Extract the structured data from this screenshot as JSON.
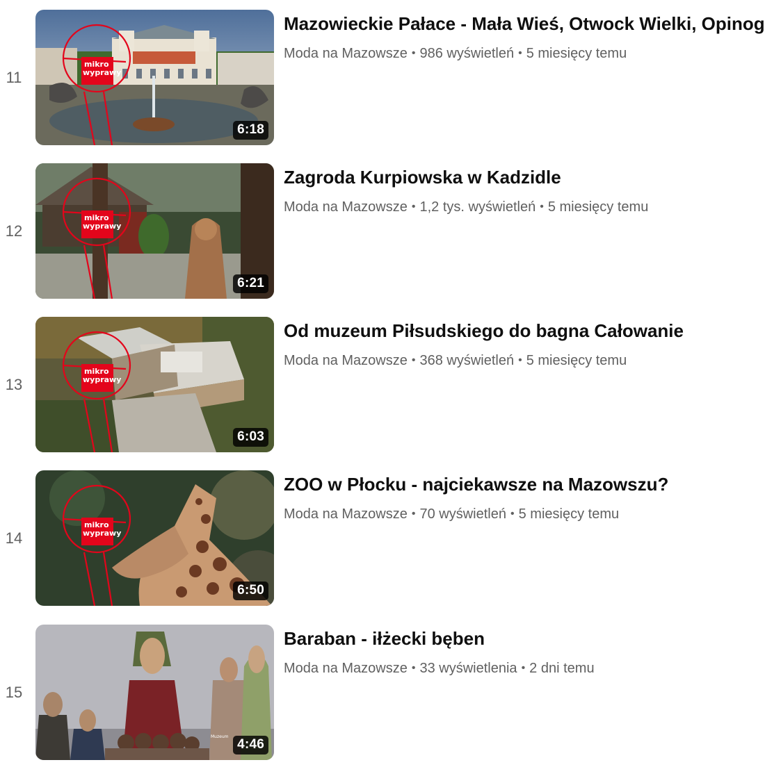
{
  "videos": [
    {
      "index": "11",
      "title": "Mazowieckie Pałace - Mała Wieś, Otwock Wielki, Opinogóra",
      "channel": "Moda na Mazowsze",
      "views": "986 wyświetleń",
      "age": "5 miesięcy temu",
      "duration": "6:18",
      "logo": "mikro wyprawy"
    },
    {
      "index": "12",
      "title": "Zagroda Kurpiowska w Kadzidle",
      "channel": "Moda na Mazowsze",
      "views": "1,2 tys. wyświetleń",
      "age": "5 miesięcy temu",
      "duration": "6:21",
      "logo": "mikro wyprawy"
    },
    {
      "index": "13",
      "title": "Od muzeum Piłsudskiego do bagna Całowanie",
      "channel": "Moda na Mazowsze",
      "views": "368 wyświetleń",
      "age": "5 miesięcy temu",
      "duration": "6:03",
      "logo": "mikro wyprawy"
    },
    {
      "index": "14",
      "title": "ZOO w Płocku - najciekawsze na Mazowszu?",
      "channel": "Moda na Mazowsze",
      "views": "70 wyświetleń",
      "age": "5 miesięcy temu",
      "duration": "6:50",
      "logo": "mikro wyprawy"
    },
    {
      "index": "15",
      "title": "Baraban - iłżecki bęben",
      "channel": "Moda na Mazowsze",
      "views": "33 wyświetlenia",
      "age": "2 dni temu",
      "duration": "4:46"
    }
  ],
  "colors": {
    "logo_red": "#e3051b",
    "meta_text": "#606060",
    "title_text": "#0f0f0f"
  }
}
